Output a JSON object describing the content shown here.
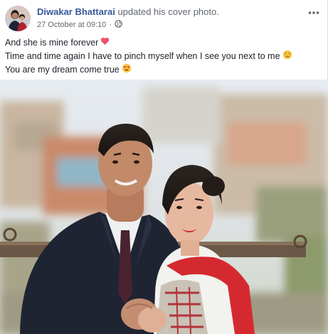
{
  "post": {
    "author": "Diwakar Bhattarai",
    "action": "updated his cover photo.",
    "timestamp": "27 October at 09:10",
    "separator": "·",
    "privacy_icon": "globe-icon",
    "more_icon": "more-options-icon",
    "lines": [
      {
        "text": "And she is mine forever",
        "emoji": "heart-icon"
      },
      {
        "text": "Time and time again I have to pinch myself when I see you next to me",
        "emoji": "crying-face-icon"
      },
      {
        "text": "You are my dream come true",
        "emoji": "heart-eyes-icon"
      }
    ],
    "photo": "couple-cover-photo"
  },
  "colors": {
    "author_link": "#365899",
    "meta_text": "#616770",
    "body_text": "#1d2129",
    "heart": "#f25268",
    "emoji_yellow": "#f7c33b"
  }
}
